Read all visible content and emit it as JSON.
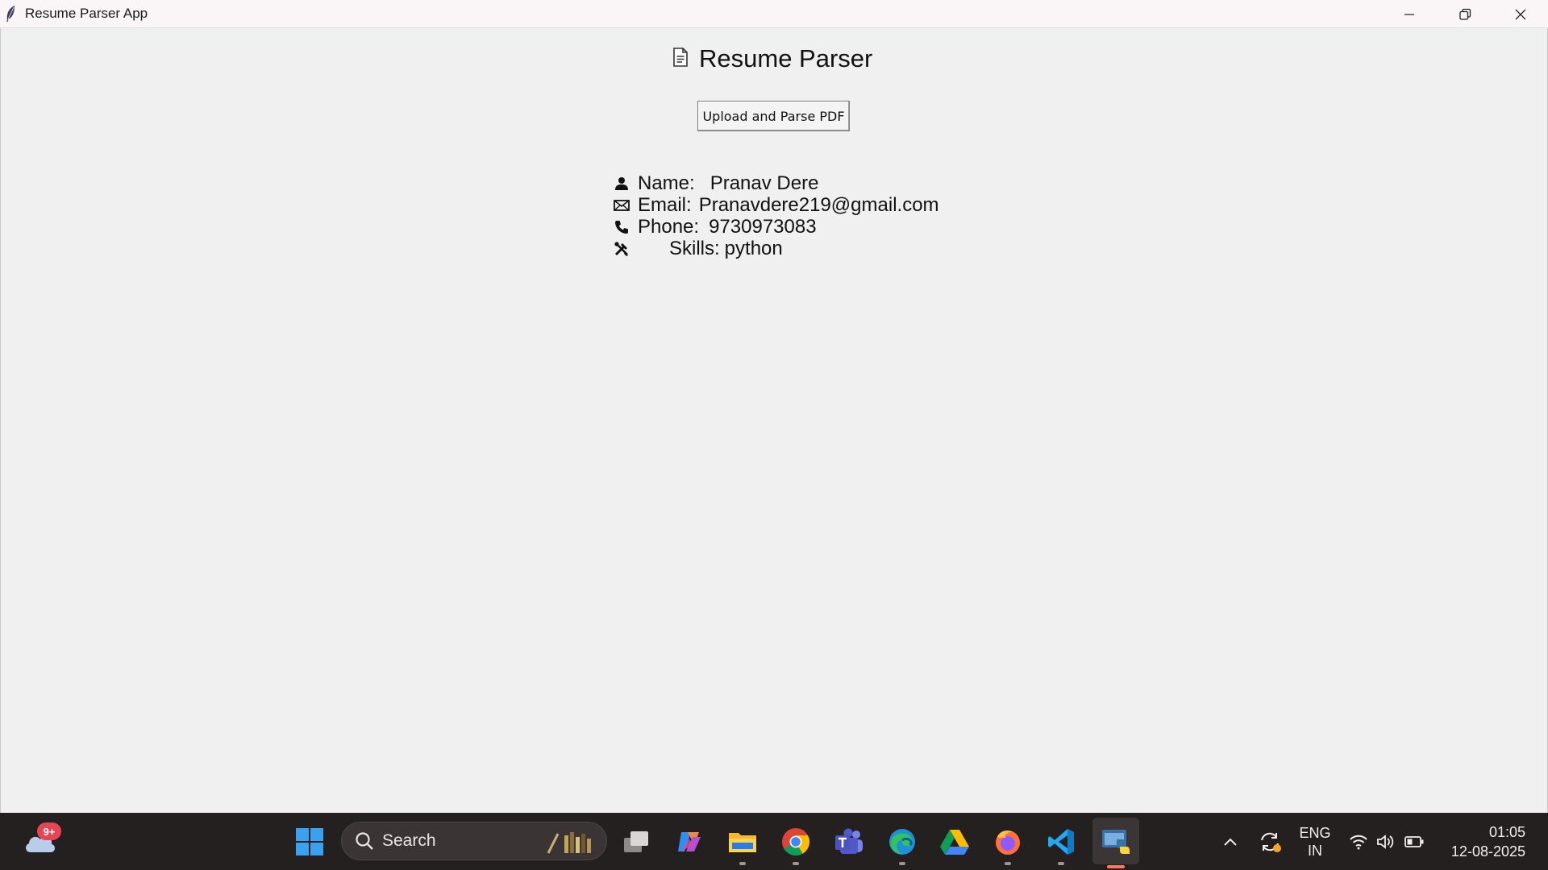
{
  "window": {
    "title": "Resume Parser App",
    "icon": "feather-icon",
    "controls": [
      "minimize-icon",
      "restore-icon",
      "close-icon"
    ]
  },
  "app": {
    "heading": "Resume Parser",
    "heading_icon": "document-icon",
    "upload_button": "Upload and Parse PDF",
    "fields": [
      {
        "icon": "person-icon",
        "label": "Name:",
        "value": "Pranav Dere"
      },
      {
        "icon": "envelope-icon",
        "label": "Email:",
        "value": "Pranavdere219@gmail.com"
      },
      {
        "icon": "phone-icon",
        "label": "Phone:",
        "value": "9730973083"
      },
      {
        "icon": "tools-icon",
        "label": "Skills:",
        "value": "python"
      }
    ]
  },
  "taskbar": {
    "weather_badge": "9+",
    "search_placeholder": "Search",
    "apps": [
      "task-view-icon",
      "copilot-icon",
      "file-explorer-icon",
      "chrome-icon",
      "teams-icon",
      "edge-icon",
      "google-drive-icon",
      "firefox-icon",
      "vscode-icon",
      "python-icon"
    ],
    "tray": {
      "language_line1": "ENG",
      "language_line2": "IN",
      "time": "01:05",
      "date": "12-08-2025"
    },
    "colors": {
      "taskbar_bg": "#24201f",
      "active_indicator": "#ff7a59",
      "badge": "#e64553"
    }
  }
}
